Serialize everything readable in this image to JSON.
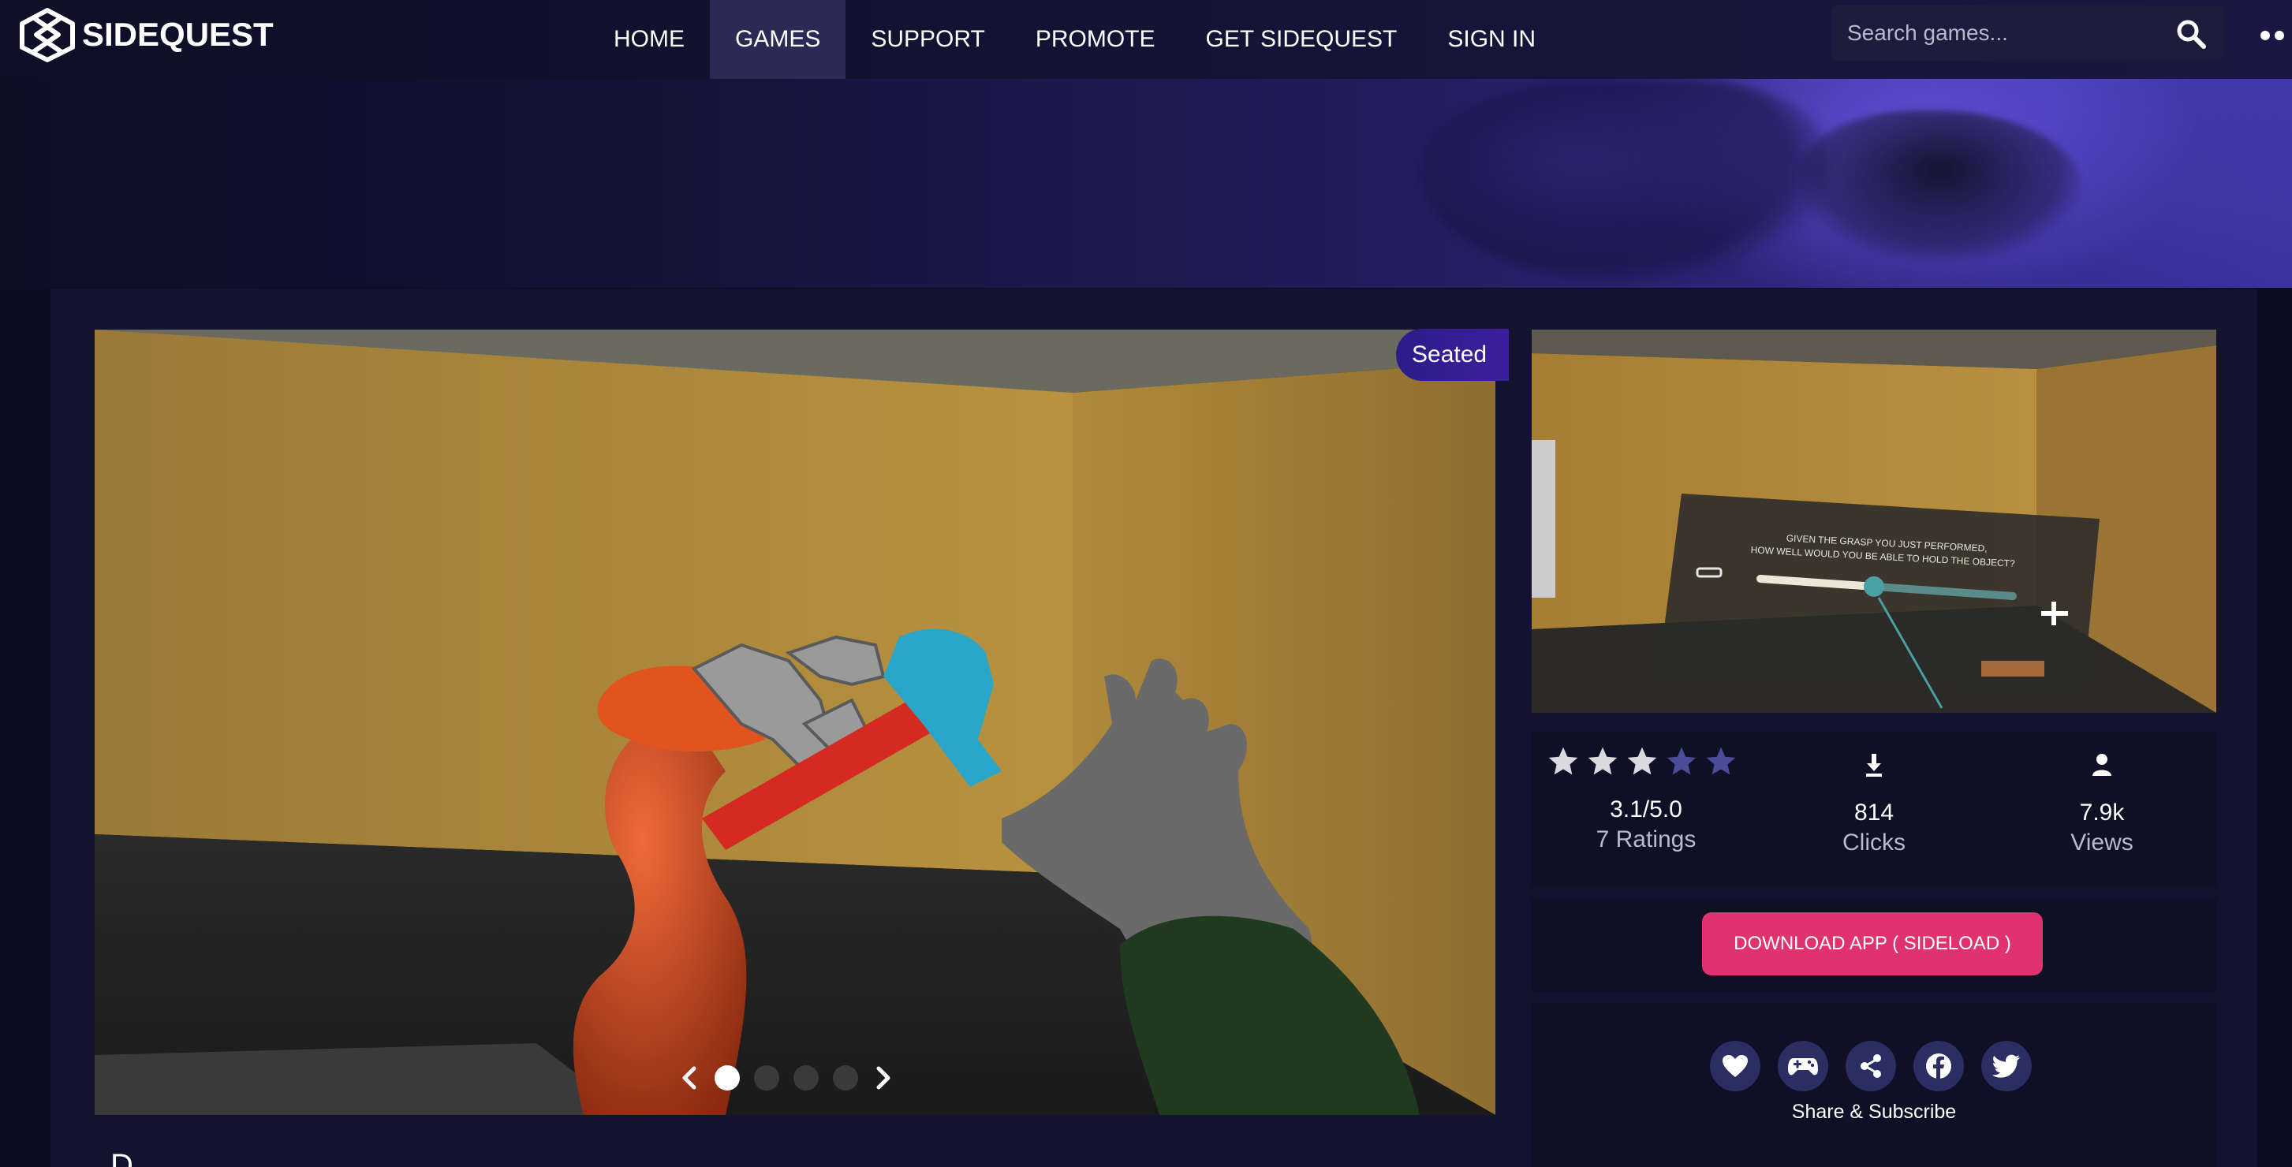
{
  "nav": {
    "logo_text": "SIDEQUEST",
    "links": [
      "HOME",
      "GAMES",
      "SUPPORT",
      "PROMOTE",
      "GET SIDEQUEST",
      "SIGN IN"
    ],
    "active_link": "GAMES",
    "search_placeholder": "Search games..."
  },
  "hero": {
    "badge": "Seated",
    "carousel_pages": 4,
    "carousel_active": 1
  },
  "side_screenshot": {
    "question_line1": "GIVEN THE GRASP YOU JUST PERFORMED,",
    "question_line2": "HOW WELL WOULD YOU BE ABLE TO HOLD THE OBJECT?",
    "slider_value": 0.45
  },
  "stats": {
    "rating_value": 3.1,
    "rating_text": "3.1/5.0",
    "ratings_label": "7 Ratings",
    "clicks_value": "814",
    "clicks_label": "Clicks",
    "views_value": "7.9k",
    "views_label": "Views"
  },
  "download": {
    "label": "DOWNLOAD APP ( SIDELOAD )"
  },
  "share": {
    "buttons": [
      "heart-icon",
      "gamepad-icon",
      "share-icon",
      "facebook-icon",
      "twitter-icon"
    ],
    "label": "Share & Subscribe"
  },
  "description": {
    "title": "D"
  },
  "colors": {
    "accent": "#e0326e",
    "badge": "#2c1c88",
    "panel": "#131330",
    "card": "#0f0f26",
    "star_on": "#d9d9de",
    "star_off": "#4a4c9a"
  }
}
